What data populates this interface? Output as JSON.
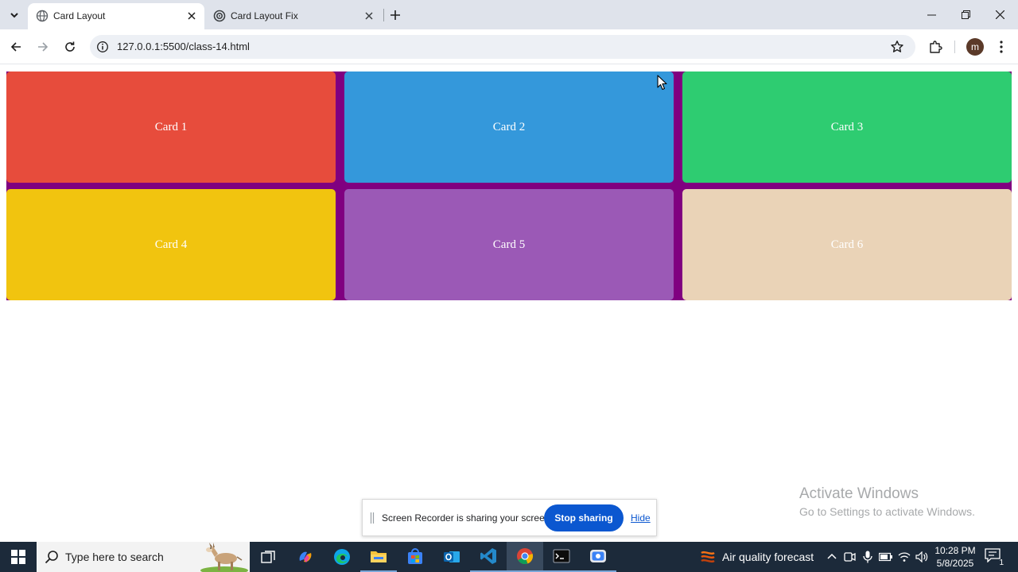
{
  "browser": {
    "tabs": [
      {
        "title": "Card Layout",
        "active": true
      },
      {
        "title": "Card Layout Fix",
        "active": false
      }
    ],
    "url": "127.0.0.1:5500/class-14.html",
    "profile_initial": "m"
  },
  "page": {
    "background": "#800080",
    "cards": [
      {
        "label": "Card 1",
        "color": "#e74c3c"
      },
      {
        "label": "Card 2",
        "color": "#3498db"
      },
      {
        "label": "Card 3",
        "color": "#2ecc71"
      },
      {
        "label": "Card 4",
        "color": "#f1c40f"
      },
      {
        "label": "Card 5",
        "color": "#9b59b6"
      },
      {
        "label": "Card 6",
        "color": "#ead3b7"
      }
    ]
  },
  "watermark": {
    "line1": "Activate Windows",
    "line2": "Go to Settings to activate Windows."
  },
  "share_bar": {
    "message": "Screen Recorder is sharing your screen.",
    "stop_label": "Stop sharing",
    "hide_label": "Hide"
  },
  "taskbar": {
    "search_placeholder": "Type here to search",
    "weather": "Air quality forecast",
    "time": "10:28 PM",
    "date": "5/8/2025",
    "notification_count": "1",
    "apps": [
      "task-view-icon",
      "copilot-icon",
      "edge-icon",
      "file-explorer-icon",
      "store-icon",
      "outlook-icon",
      "vscode-icon",
      "chrome-icon",
      "terminal-icon",
      "screen-recorder-icon"
    ]
  }
}
